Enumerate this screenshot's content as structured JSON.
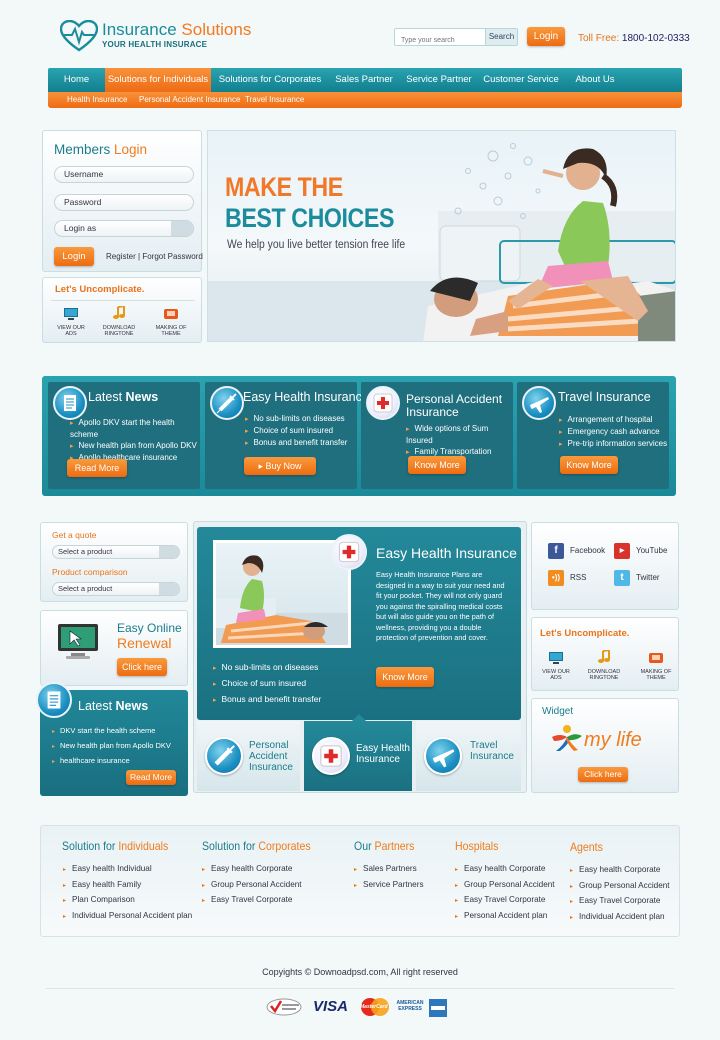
{
  "header": {
    "logo_title_a": "Insurance",
    "logo_title_b": " Solutions",
    "logo_sub": "YOUR HEALTH INSURACE",
    "search_placeholder": "Type your search",
    "search_button": "Search",
    "login_button": "Login",
    "toll_label": "Toll Free:",
    "toll_number": "1800-102-0333"
  },
  "nav": {
    "items": [
      "Home",
      "Solutions for Individuals",
      "Solutions for Corporates",
      "Sales Partner",
      "Service Partner",
      "Customer Service",
      "About Us"
    ],
    "active": "Solutions for Individuals",
    "sub": [
      "Health Insurance",
      "Personal Accident Insurance",
      "Travel Insurance"
    ]
  },
  "members": {
    "title_a": "Members ",
    "title_b": "Login",
    "username": "Username",
    "password": "Password",
    "login_as": "Login as",
    "login_button": "Login",
    "register": "Register",
    "forgot": "Forgot Password"
  },
  "uncomplicate": {
    "title": "Let's Uncomplicate.",
    "items": [
      "VIEW OUR ADS",
      "DOWNLOAD RINGTONE",
      "MAKING OF THEME"
    ]
  },
  "banner": {
    "line1": "MAKE THE",
    "line2": "BEST CHOICES",
    "subtitle": "We help you live better tension free life"
  },
  "features": [
    {
      "title_a": "Latest ",
      "title_b": "News",
      "items": [
        "Apollo DKV start the health scheme",
        "New health plan from Apollo DKV",
        "Apollo healthcare insurance"
      ],
      "button": "Read More",
      "icon": "news-icon"
    },
    {
      "title_a": "Easy Health ",
      "title_b": "Insurance",
      "items": [
        "No sub-limits on diseases",
        "Choice of sum insured",
        "Bonus and benefit transfer"
      ],
      "button": "Buy Now",
      "icon": "syringe-icon"
    },
    {
      "title_a": "Personal Accident",
      "title_b": "Insurance",
      "items": [
        "Wide options of Sum Insured",
        "Family Transportation"
      ],
      "button": "Know More",
      "icon": "medical-cross-icon"
    },
    {
      "title_a": "Travel ",
      "title_b": "Insurance",
      "items": [
        "Arrangement of hospital",
        "Emergency cash advance",
        "Pre-trip information services"
      ],
      "button": "Know More",
      "icon": "airplane-icon"
    }
  ],
  "quote": {
    "get_quote": "Get a quote",
    "select1": "Select a product",
    "comparison": "Product comparison",
    "select2": "Select a product"
  },
  "renewal": {
    "line1": "Easy Online",
    "line2": "Renewal",
    "button": "Click here"
  },
  "latest_news": {
    "title_a": "Latest ",
    "title_b": "News",
    "items": [
      "DKV start the health scheme",
      "New health plan from Apollo DKV",
      "healthcare insurance"
    ],
    "button": "Read More"
  },
  "easy_health": {
    "title": "Easy Health Insurance",
    "text": "Easy Health Insurance Plans are designed in a way to suit your need and fit your pocket. They will not only guard you against the spiralling medical costs but will also guide you on the path of wellness, providing you a double protection of prevention and cover.",
    "button": "Know More",
    "items": [
      "No sub-limits on diseases",
      "Choice of sum insured",
      "Bonus and benefit transfer"
    ],
    "tabs": [
      {
        "line1": "Personal",
        "line2": "Accident",
        "line3": "Insurance"
      },
      {
        "line1": "Easy Health",
        "line2": "Insurance",
        "line3": ""
      },
      {
        "line1": "Travel",
        "line2": "Insurance",
        "line3": ""
      }
    ]
  },
  "social": {
    "items": [
      "Facebook",
      "YouTube",
      "RSS",
      "Twitter"
    ],
    "colors": {
      "facebook": "#3b5998",
      "youtube": "#d8322a",
      "rss": "#f28c1e",
      "twitter": "#4fb9e6"
    }
  },
  "widget": {
    "title": "Widget",
    "brand": "my life",
    "button": "Click here"
  },
  "footer": {
    "columns": [
      {
        "title_a": "Solution for ",
        "title_b": "Individuals",
        "items": [
          "Easy health Individual",
          "Easy health Family",
          "Plan Comparison",
          "Individual Personal Accident plan"
        ]
      },
      {
        "title_a": "Solution for ",
        "title_b": "Corporates",
        "items": [
          "Easy health Corporate",
          "Group Personal Accident",
          "Easy Travel Corporate"
        ]
      },
      {
        "title_a": "Our ",
        "title_b": "Partners",
        "items": [
          "Sales Partners",
          "Service Partners"
        ]
      },
      {
        "title_a": "",
        "title_b": "Hospitals",
        "items": [
          "Easy health Corporate",
          "Group Personal Accident",
          "Easy Travel Corporate",
          "Personal Accident plan"
        ]
      },
      {
        "title_a": "",
        "title_b": "Agents",
        "items": [
          "Easy health Corporate",
          "Group Personal Accident",
          "Easy Travel Corporate",
          "Individual Accident plan"
        ]
      }
    ],
    "copyright": "Copyights © Downoadpsd.com, All right reserved",
    "payments": [
      "VISA",
      "MasterCard",
      "AMERICAN EXPRESS"
    ]
  },
  "colors": {
    "teal": "#1a8a99",
    "orange": "#ee6b14",
    "dark_teal": "#1f6f7e"
  }
}
